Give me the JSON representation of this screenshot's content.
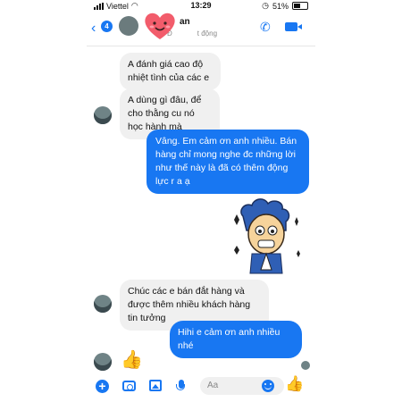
{
  "status": {
    "carrier": "Viettel",
    "time": "13:29",
    "battery": "51%"
  },
  "header": {
    "badge": "4",
    "name_fragment": "an",
    "subtitle_fragment": "Đ",
    "subtitle_rest": "t động"
  },
  "messages": [
    {
      "direction": "in",
      "text": "A đánh giá cao độ nhiệt tình của các e"
    },
    {
      "direction": "in",
      "text": "A dùng gì đâu, để cho thằng cu nó học hành mà"
    },
    {
      "direction": "out",
      "text": "Vâng. Em cảm ơn anh nhiều. Bán hàng chỉ mong nghe đc những lời như thế này là đã có thêm động lực r a ạ"
    },
    {
      "direction": "in",
      "text": "Chúc các e bán đắt hàng và được thêm nhiều khách hàng tin tưởng"
    },
    {
      "direction": "out",
      "text": "Hihi e cảm ơn anh nhiều nhé"
    }
  ],
  "composer": {
    "placeholder": "Aa"
  },
  "colors": {
    "accent": "#1877f2",
    "incoming_bubble": "#f0f0f0",
    "heart": "#f25c6b"
  },
  "icons": [
    "back-chevron-icon",
    "phone-icon",
    "video-icon",
    "plus-icon",
    "camera-icon",
    "image-icon",
    "mic-icon",
    "emoji-icon",
    "thumbs-up-icon",
    "heart-emoji-icon",
    "sticker-icon"
  ]
}
